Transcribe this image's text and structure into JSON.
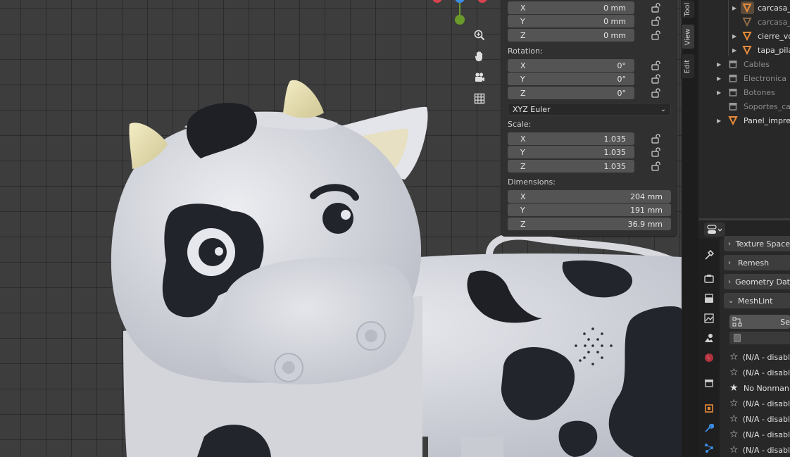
{
  "npanel": {
    "location": [
      {
        "axis": "X",
        "value": "0 mm"
      },
      {
        "axis": "Y",
        "value": "0 mm"
      },
      {
        "axis": "Z",
        "value": "0 mm"
      }
    ],
    "rotation_label": "Rotation:",
    "rotation": [
      {
        "axis": "X",
        "value": "0°"
      },
      {
        "axis": "Y",
        "value": "0°"
      },
      {
        "axis": "Z",
        "value": "0°"
      }
    ],
    "rotation_mode": "XYZ Euler",
    "scale_label": "Scale:",
    "scale": [
      {
        "axis": "X",
        "value": "1.035"
      },
      {
        "axis": "Y",
        "value": "1.035"
      },
      {
        "axis": "Z",
        "value": "1.035"
      }
    ],
    "dimensions_label": "Dimensions:",
    "dimensions": [
      {
        "axis": "X",
        "value": "204 mm"
      },
      {
        "axis": "Y",
        "value": "191 mm"
      },
      {
        "axis": "Z",
        "value": "36.9 mm"
      }
    ]
  },
  "side_tabs": [
    "Tool",
    "View",
    "Edit"
  ],
  "outliner": {
    "items": [
      {
        "label": "carcasa_a",
        "type": "mesh",
        "active": true
      },
      {
        "label": "carcasa_a",
        "type": "mesh",
        "dim": true
      },
      {
        "label": "cierre_vol",
        "type": "mesh"
      },
      {
        "label": "tapa_pila",
        "type": "mesh"
      },
      {
        "label": "Cables",
        "type": "collection",
        "dim": true
      },
      {
        "label": "Electronica",
        "type": "collection",
        "dim": true
      },
      {
        "label": "Botones",
        "type": "collection",
        "dim": true
      },
      {
        "label": "Soportes_car",
        "type": "collection",
        "dim": true
      },
      {
        "label": "Panel_impres",
        "type": "mesh"
      }
    ]
  },
  "properties": {
    "panels": [
      "Texture Space",
      "Remesh",
      "Geometry Dat",
      "MeshLint"
    ],
    "select_button": "Se",
    "meshlint_items": [
      {
        "label": "(N/A - disabl",
        "filled": false
      },
      {
        "label": "(N/A - disabl",
        "filled": false
      },
      {
        "label": "No Nonman",
        "filled": true
      },
      {
        "label": "(N/A - disabl",
        "filled": false
      },
      {
        "label": "(N/A - disabl",
        "filled": false
      },
      {
        "label": "(N/A - disabl",
        "filled": false
      },
      {
        "label": "(N/A - disabl",
        "filled": false
      }
    ]
  },
  "colors": {
    "accent_orange": "#e88c3a",
    "gizmo_green": "#6a9a2a",
    "gizmo_red": "#d8424f",
    "gizmo_blue": "#3b8ee6"
  }
}
